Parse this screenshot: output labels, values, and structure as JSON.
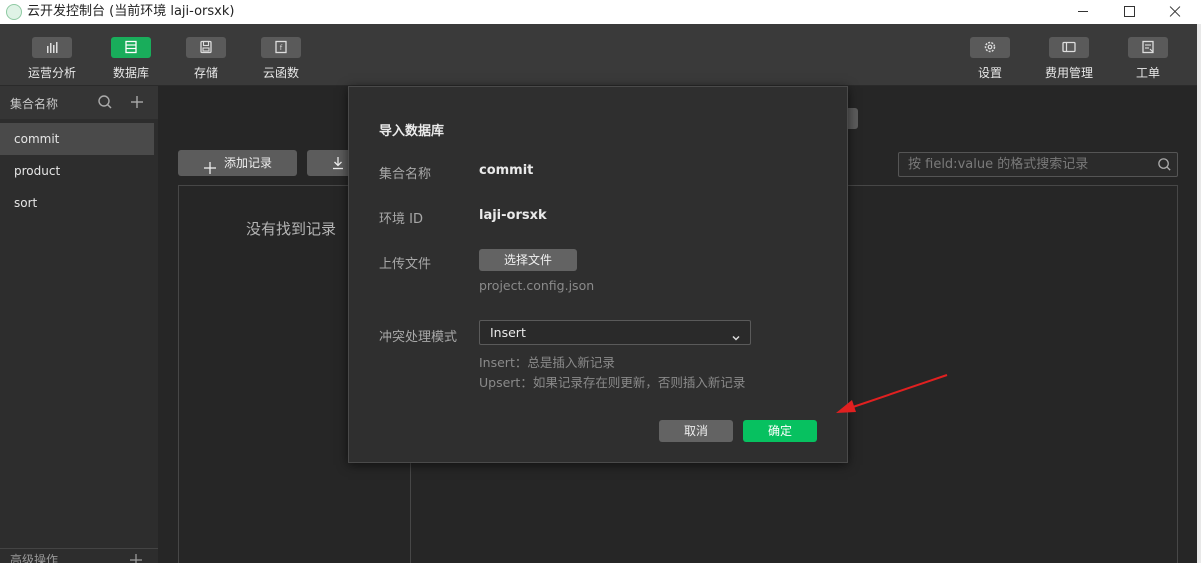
{
  "window": {
    "title": "云开发控制台 (当前环境 laji-orsxk)"
  },
  "toolbar": {
    "left_items": [
      {
        "label": "运营分析",
        "icon": "bar-chart-icon"
      },
      {
        "label": "数据库",
        "icon": "database-icon",
        "active": true
      },
      {
        "label": "存储",
        "icon": "storage-icon"
      },
      {
        "label": "云函数",
        "icon": "cloud-function-icon"
      }
    ],
    "right_items": [
      {
        "label": "设置",
        "icon": "gear-icon"
      },
      {
        "label": "费用管理",
        "icon": "billing-icon"
      },
      {
        "label": "工单",
        "icon": "ticket-icon"
      }
    ]
  },
  "sidebar": {
    "header_label": "集合名称",
    "collections": [
      "commit",
      "product",
      "sort"
    ],
    "active_collection": "commit",
    "footer_label": "高级操作"
  },
  "main": {
    "add_record_label": "添加记录",
    "search_placeholder": "按 field:value 的格式搜索记录",
    "empty_text": "没有找到记录"
  },
  "import_dialog": {
    "title": "导入数据库",
    "collection_label": "集合名称",
    "collection_value": "commit",
    "env_label": "环境 ID",
    "env_value": "laji-orsxk",
    "upload_label": "上传文件",
    "choose_file_label": "选择文件",
    "file_name": "project.config.json",
    "conflict_label": "冲突处理模式",
    "conflict_selected": "Insert",
    "hint_insert": "Insert：总是插入新记录",
    "hint_upsert": "Upsert：如果记录存在则更新，否则插入新记录",
    "cancel_label": "取消",
    "confirm_label": "确定"
  },
  "colors": {
    "accent_green": "#07c160",
    "annotation_red": "#e02020"
  }
}
